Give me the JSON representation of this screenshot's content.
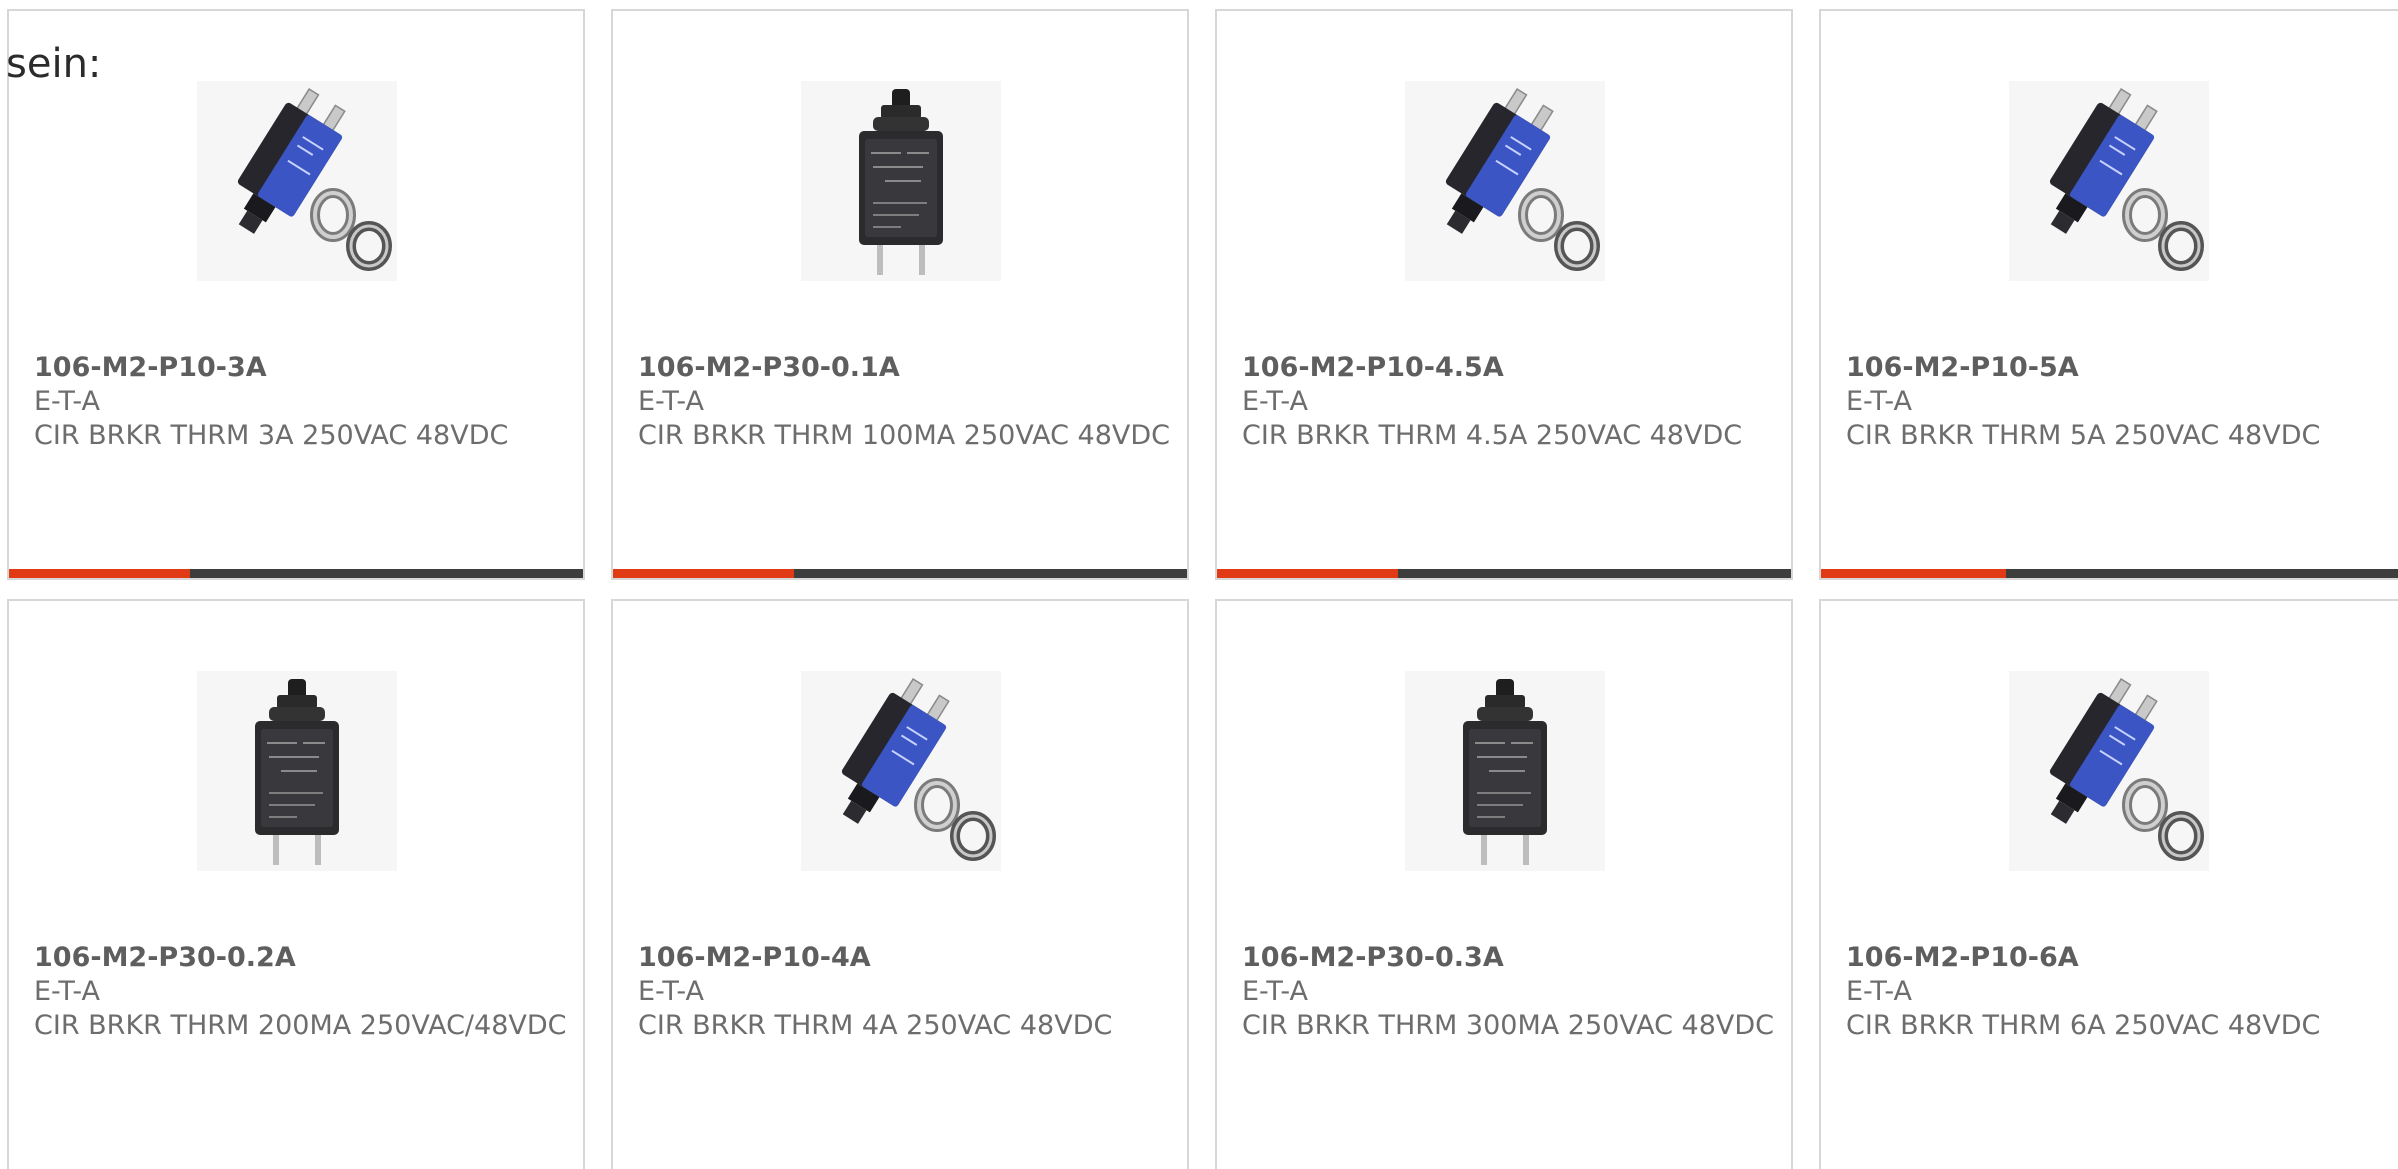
{
  "intro_text": "sein:",
  "colors": {
    "accent": "#e03b14",
    "bar_track": "#3d3d3d",
    "card_border": "#d7d7d7"
  },
  "products": [
    {
      "part_number": "106-M2-P10-3A",
      "manufacturer": "E-T-A",
      "description": "CIR BRKR THRM 3A 250VAC 48VDC",
      "image": "breaker-panel-mount-icon",
      "progress": 0.315
    },
    {
      "part_number": "106-M2-P30-0.1A",
      "manufacturer": "E-T-A",
      "description": "CIR BRKR THRM 100MA 250VAC 48VDC",
      "image": "breaker-pushbutton-icon",
      "progress": 0.315
    },
    {
      "part_number": "106-M2-P10-4.5A",
      "manufacturer": "E-T-A",
      "description": "CIR BRKR THRM 4.5A 250VAC 48VDC",
      "image": "breaker-panel-mount-icon",
      "progress": 0.315
    },
    {
      "part_number": "106-M2-P10-5A",
      "manufacturer": "E-T-A",
      "description": "CIR BRKR THRM 5A 250VAC 48VDC",
      "image": "breaker-panel-mount-icon",
      "progress": 0.315
    },
    {
      "part_number": "106-M2-P30-0.2A",
      "manufacturer": "E-T-A",
      "description": "CIR BRKR THRM 200MA 250VAC/48VDC",
      "image": "breaker-pushbutton-icon",
      "progress": null
    },
    {
      "part_number": "106-M2-P10-4A",
      "manufacturer": "E-T-A",
      "description": "CIR BRKR THRM 4A 250VAC 48VDC",
      "image": "breaker-panel-mount-icon",
      "progress": null
    },
    {
      "part_number": "106-M2-P30-0.3A",
      "manufacturer": "E-T-A",
      "description": "CIR BRKR THRM 300MA 250VAC 48VDC",
      "image": "breaker-pushbutton-icon",
      "progress": null
    },
    {
      "part_number": "106-M2-P10-6A",
      "manufacturer": "E-T-A",
      "description": "CIR BRKR THRM 6A 250VAC 48VDC",
      "image": "breaker-panel-mount-icon",
      "progress": null
    }
  ]
}
